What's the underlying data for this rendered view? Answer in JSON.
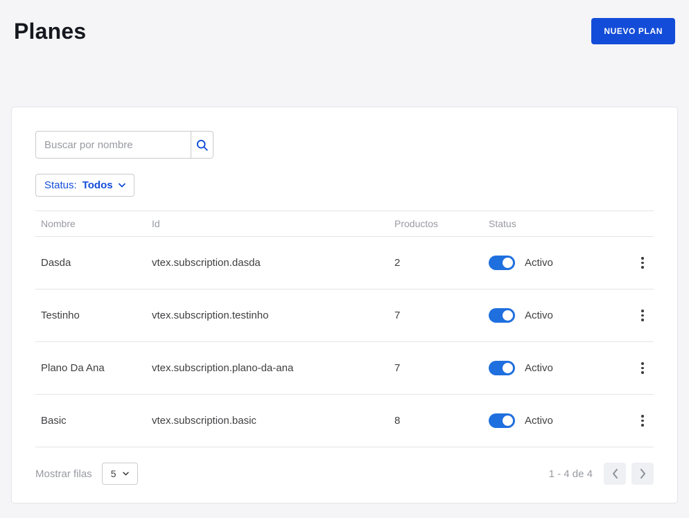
{
  "page": {
    "title": "Planes"
  },
  "header": {
    "new_plan_button": "NUEVO PLAN"
  },
  "search": {
    "placeholder": "Buscar por nombre",
    "value": ""
  },
  "filters": {
    "status_label": "Status:",
    "status_value": "Todos"
  },
  "table": {
    "columns": [
      "Nombre",
      "Id",
      "Productos",
      "Status"
    ],
    "rows": [
      {
        "name": "Dasda",
        "id": "vtex.subscription.dasda",
        "products": "2",
        "status": "Activo",
        "active": true
      },
      {
        "name": "Testinho",
        "id": "vtex.subscription.testinho",
        "products": "7",
        "status": "Activo",
        "active": true
      },
      {
        "name": "Plano Da Ana",
        "id": "vtex.subscription.plano-da-ana",
        "products": "7",
        "status": "Activo",
        "active": true
      },
      {
        "name": "Basic",
        "id": "vtex.subscription.basic",
        "products": "8",
        "status": "Activo",
        "active": true
      }
    ]
  },
  "footer": {
    "rows_label": "Mostrar filas",
    "rows_per_page": "5",
    "range": "1 - 4 de 4"
  },
  "colors": {
    "accent": "#134cd8",
    "toggle_active": "#1f6fde",
    "heading": "#16181f",
    "muted_text": "#979aa0",
    "border": "#e3e4e6"
  }
}
